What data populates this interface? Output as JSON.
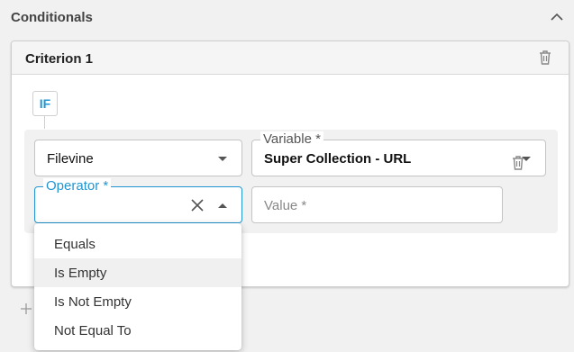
{
  "section": {
    "title": "Conditionals",
    "collapse_icon": "chevron-up-icon"
  },
  "criterion": {
    "title": "Criterion 1",
    "delete_icon": "trash-icon",
    "if_label": "IF"
  },
  "fields": {
    "source": {
      "value": "Filevine"
    },
    "variable": {
      "label": "Variable *",
      "value": "Super Collection - URL"
    },
    "operator": {
      "label": "Operator *",
      "value": ""
    },
    "value": {
      "placeholder": "Value *"
    }
  },
  "operator_options": [
    "Equals",
    "Is Empty",
    "Is Not Empty",
    "Not Equal To"
  ],
  "hovered_option": "Is Empty",
  "colors": {
    "accent": "#2196d3",
    "panel": "#f1f1f1"
  }
}
